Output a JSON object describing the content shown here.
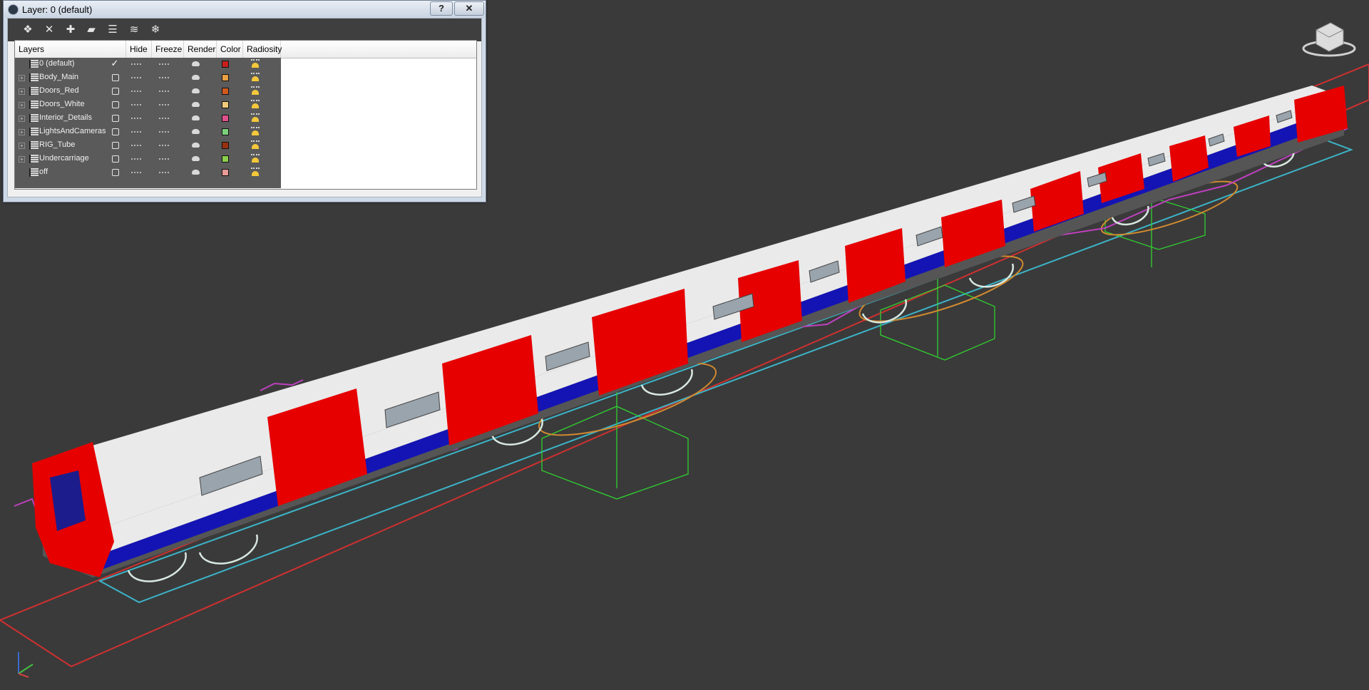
{
  "dialog": {
    "title": "Layer: 0 (default)",
    "help_label": "?",
    "close_label": "✕"
  },
  "toolbar": {
    "icons": [
      "new-layer-icon",
      "delete-layer-icon",
      "add-to-layer-icon",
      "select-objects-icon",
      "select-layer-icon",
      "hide-all-icon",
      "freeze-all-icon"
    ]
  },
  "columns": [
    "Layers",
    "Hide",
    "Freeze",
    "Render",
    "Color",
    "Radiosity"
  ],
  "layers": [
    {
      "name": "0 (default)",
      "current": true,
      "color": "#c81e1e"
    },
    {
      "name": "Body_Main",
      "current": false,
      "color": "#e8a040"
    },
    {
      "name": "Doors_Red",
      "current": false,
      "color": "#d25a1e"
    },
    {
      "name": "Doors_White",
      "current": false,
      "color": "#f0cc7a"
    },
    {
      "name": "Interior_Details",
      "current": false,
      "color": "#e0508a"
    },
    {
      "name": "LightsAndCameras",
      "current": false,
      "color": "#7cd07c"
    },
    {
      "name": "RIG_Tube",
      "current": false,
      "color": "#9a3010"
    },
    {
      "name": "Undercarriage",
      "current": false,
      "color": "#8ccf4a"
    },
    {
      "name": "off",
      "current": false,
      "color": "#e89a96"
    }
  ],
  "viewport": {
    "background": "#3a3a3a",
    "train_red": "#e60000",
    "train_white": "#eaeaea",
    "train_blue": "#1414b4",
    "roof": "#555555"
  }
}
